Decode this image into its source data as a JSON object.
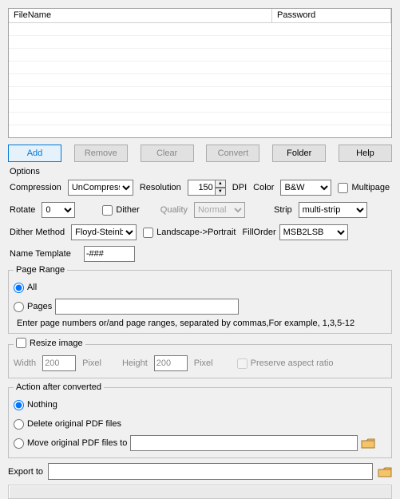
{
  "table": {
    "col_filename": "FileName",
    "col_password": "Password"
  },
  "buttons": {
    "add": "Add",
    "remove": "Remove",
    "clear": "Clear",
    "convert": "Convert",
    "folder": "Folder",
    "help": "Help"
  },
  "options": {
    "title": "Options",
    "compression_label": "Compression",
    "compression_value": "UnCompressed",
    "resolution_label": "Resolution",
    "resolution_value": "150",
    "dpi_label": "DPI",
    "color_label": "Color",
    "color_value": "B&W",
    "multipage_label": "Multipage",
    "rotate_label": "Rotate",
    "rotate_value": "0",
    "dither_label": "Dither",
    "quality_label": "Quality",
    "quality_value": "Normal",
    "strip_label": "Strip",
    "strip_value": "multi-strip",
    "dither_method_label": "Dither Method",
    "dither_method_value": "Floyd-Steinberg",
    "landscape_portrait_label": "Landscape->Portrait",
    "fillorder_label": "FillOrder",
    "fillorder_value": "MSB2LSB"
  },
  "name_template": {
    "label": "Name Template",
    "value": "-###"
  },
  "page_range": {
    "title": "Page Range",
    "all_label": "All",
    "pages_label": "Pages",
    "pages_value": "",
    "note": "Enter page numbers or/and page ranges, separated by commas,For example, 1,3,5-12"
  },
  "resize": {
    "title": "Resize image",
    "width_label": "Width",
    "width_value": "200",
    "pixel_label": "Pixel",
    "height_label": "Height",
    "height_value": "200",
    "preserve_label": "Preserve aspect ratio"
  },
  "action": {
    "title": "Action after converted",
    "nothing_label": "Nothing",
    "delete_label": "Delete original PDF files",
    "move_label": "Move original PDF files to",
    "move_path": ""
  },
  "export": {
    "label": "Export to",
    "value": ""
  }
}
